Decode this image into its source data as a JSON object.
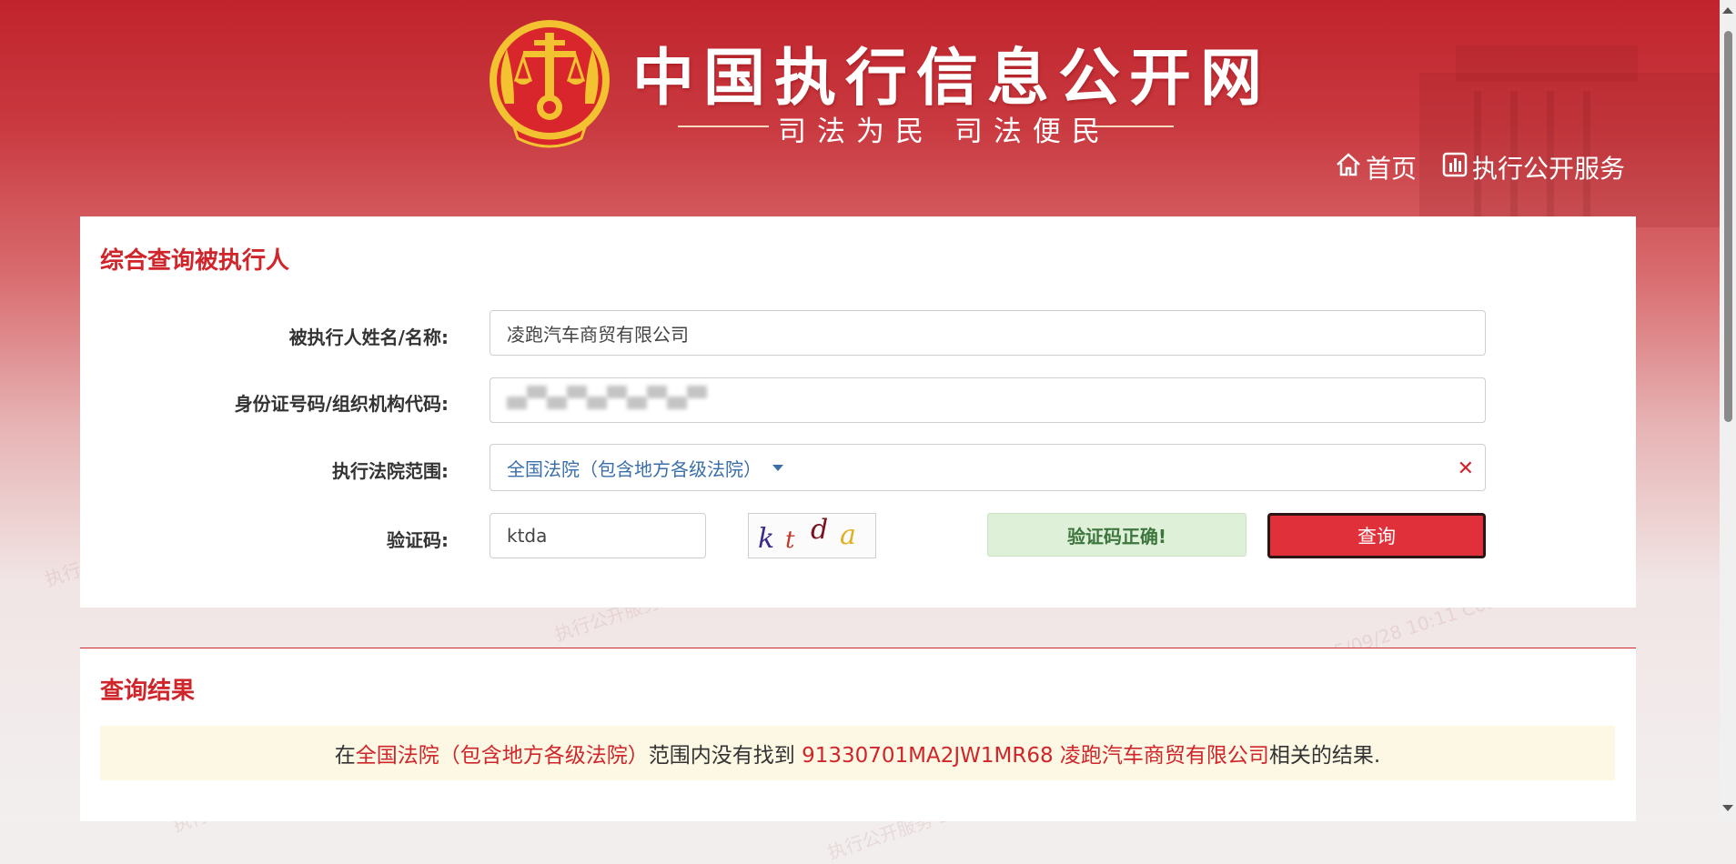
{
  "header": {
    "site_title": "中国执行信息公开网",
    "slogan": "司法为民   司法便民",
    "nav": [
      {
        "label": "首页",
        "icon": "home-icon"
      },
      {
        "label": "执行公开服务",
        "icon": "chart-icon"
      }
    ]
  },
  "search_form": {
    "title": "综合查询被执行人",
    "name_label": "被执行人姓名/名称:",
    "name_value": "凌跑汽车商贸有限公司",
    "id_label": "身份证号码/组织机构代码:",
    "court_label": "执行法院范围:",
    "court_value": "全国法院（包含地方各级法院）",
    "captcha_label": "验证码:",
    "captcha_value": "ktda",
    "captcha_image_chars": [
      "k",
      "t",
      "d",
      "a"
    ],
    "captcha_status": "验证码正确!",
    "query_button": "查询"
  },
  "results": {
    "title": "查询结果",
    "msg_prefix": "在",
    "msg_scope": "全国法院（包含地方各级法院）",
    "msg_mid": "范围内没有找到 ",
    "msg_target": "91330701MA2JW1MR68 凌跑汽车商贸有限公司",
    "msg_suffix": "相关的结果."
  },
  "colors": {
    "brand_red": "#c1232c",
    "accent_red": "#d0252b",
    "success_bg": "#def0d8",
    "notice_bg": "#fcf8e3"
  }
}
